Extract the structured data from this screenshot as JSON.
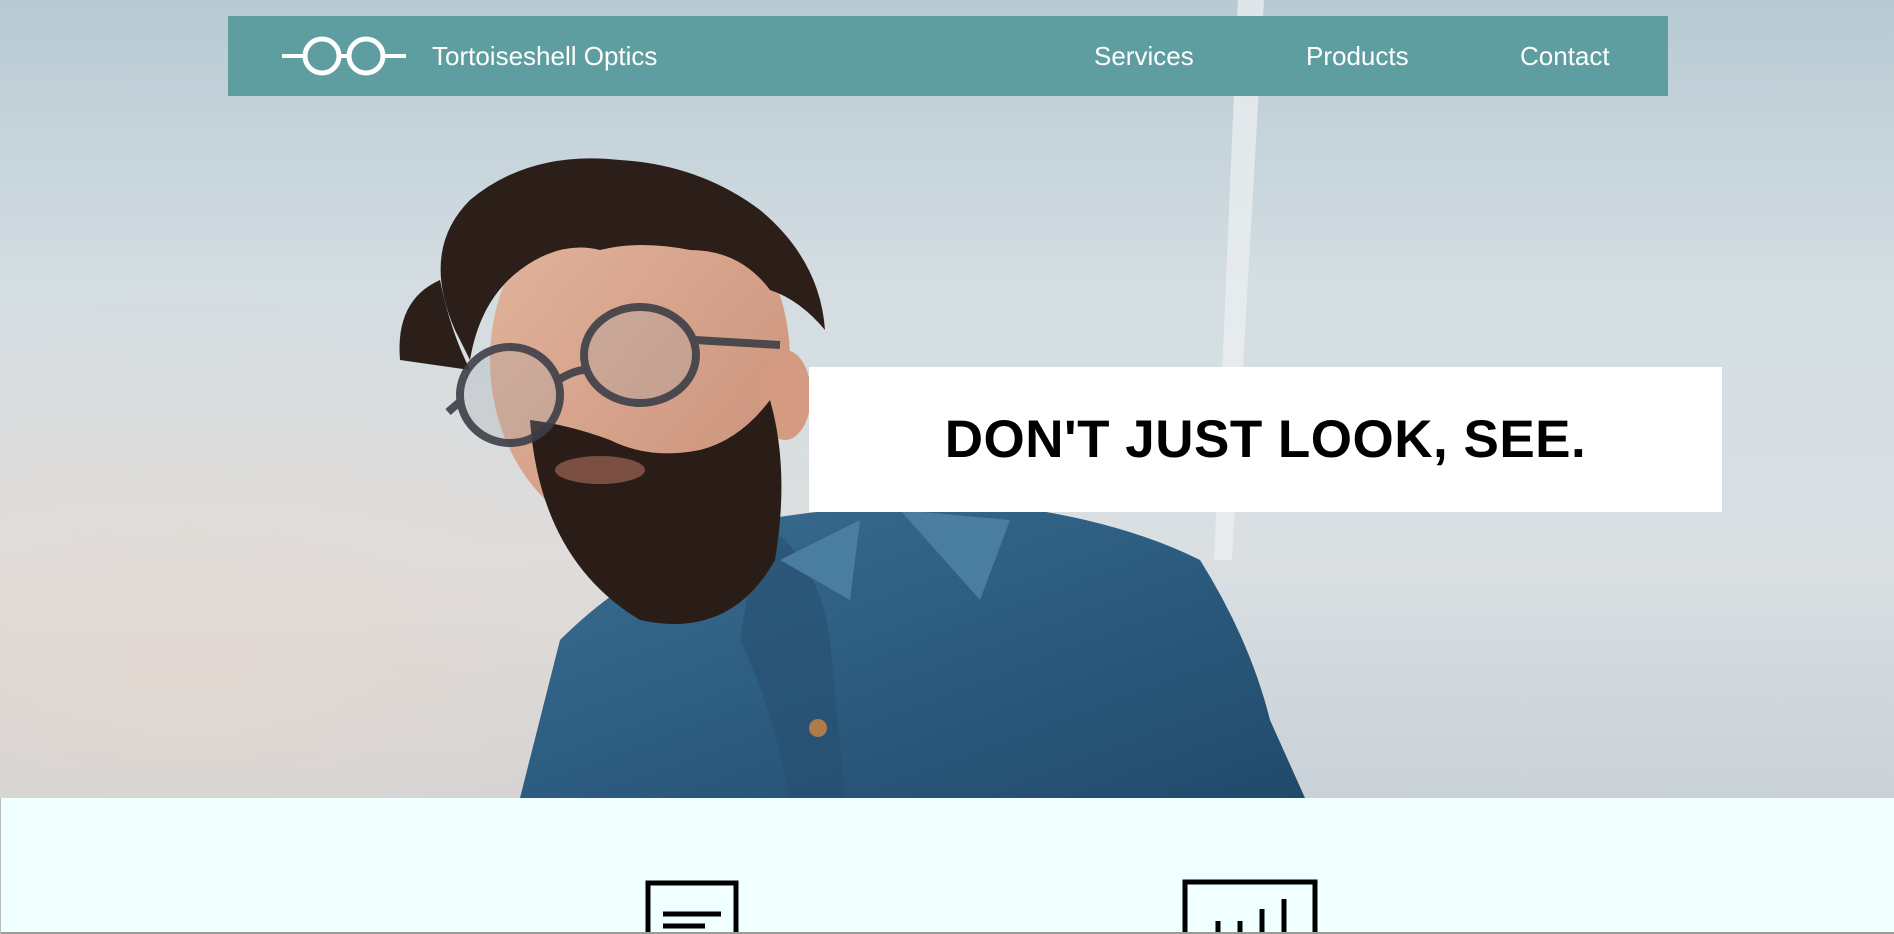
{
  "header": {
    "brand_name": "Tortoiseshell Optics",
    "logo_icon": "eyeglasses-icon",
    "nav": [
      {
        "label": "Services"
      },
      {
        "label": "Products"
      },
      {
        "label": "Contact"
      }
    ]
  },
  "hero": {
    "headline": "DON'T JUST LOOK, SEE.",
    "image": "man-with-glasses-photo"
  },
  "services": {
    "icons": [
      "document-icon",
      "bar-chart-icon"
    ]
  },
  "colors": {
    "nav_background": "#5f9ea0",
    "services_background": "#f0ffff",
    "headline_box": "#ffffff",
    "headline_text": "#000000"
  }
}
